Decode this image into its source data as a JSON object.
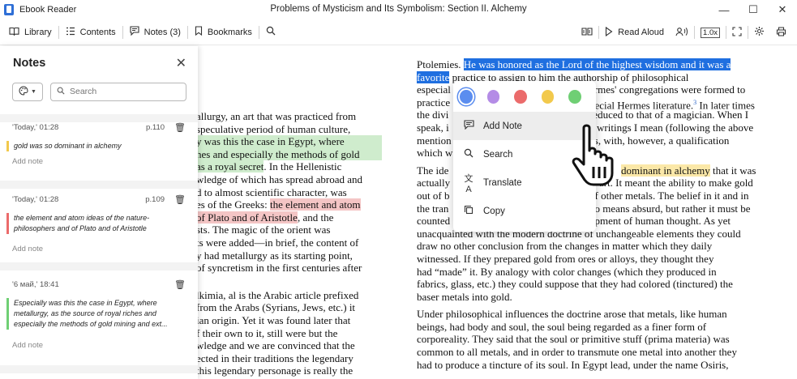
{
  "window": {
    "app_name": "Ebook Reader",
    "doc_title": "Problems of Mysticism and Its Symbolism: Section II. Alchemy",
    "controls": [
      "—",
      "☐",
      "✕"
    ]
  },
  "toolbar": {
    "library": "Library",
    "contents": "Contents",
    "notes": "Notes (3)",
    "bookmarks": "Bookmarks",
    "read_aloud": "Read Aloud",
    "speed": "1.0x"
  },
  "notes_panel": {
    "title": "Notes",
    "search_placeholder": "Search",
    "add_note_label": "Add note",
    "items": [
      {
        "time": "'Today,' 01:28",
        "page": "p.110",
        "text": "gold was so dominant in alchemy",
        "color": "#f2c94c"
      },
      {
        "time": "'Today,' 01:28",
        "page": "p.109",
        "text": "the element and atom ideas of the nature-philosophers and of Plato and of Aristotle",
        "color": "#eb6b6b"
      },
      {
        "time": "'6 май,' 18:41",
        "page": "",
        "text": "Especially was this the case in Egypt, where metallurgy, as the source of royal riches and especially the methods of gold mining and ext...",
        "color": "#6fcf74"
      }
    ]
  },
  "left_page": {
    "block1": [
      "allurgy, an art that was practiced from",
      "speculative period of human culture,",
      "y was this the case in Egypt, where",
      "hes and especially the methods of gold",
      " as a royal secret. In the Hellenistic",
      "wledge of which has spread abroad and",
      "d to almost scientific character, was",
      "es of the Greeks: the element and atom",
      " of Plato and of Aristotle, and the",
      "sts. The magic of the orient was",
      "ts were added—in brief, the content of",
      "y had metallurgy as its starting point,",
      " of syncretism in the first centuries after"
    ],
    "block2": [
      "lkimia, al is the Arabic article prefixed",
      "from the Arabs (Syrians, Jews, etc.) it",
      "ian origin. Yet it was found later that",
      "f their own to it, still were but the",
      "wledge and we are convinced that the",
      "ected in their traditions the legendary",
      "this legendary personage is really the"
    ]
  },
  "right_page": {
    "l1a": "Ptolemies. ",
    "l1b": "He was honored as the Lord of the highest wisdom and it was a",
    "l2a": "favorite",
    "l2b": " practice to assign to him the authorship of philosophical",
    "l3a": "especial",
    "l3b": "ermes' congregations were formed to",
    "l4a": "practice",
    "l4b": "pecial Hermes literature.",
    "l4sup": "3",
    "l4c": " In later times",
    "l5a": "the divi",
    "l5b": "reduced to that of a magician. When I",
    "l6a": "speak, i",
    "l6b": "c writings I mean (following the above",
    "l7a": "mention",
    "l7b": "es, with, however, a qualification",
    "l8a": "which w",
    "p2l1a": "The ide",
    "p2l1b": "dominant in alchemy",
    "p2l1c": " that it was",
    "p2l2a": "actually",
    "p2l2b": "ts art. It meant the ability to make gold",
    "p2l3a": "out of b",
    "p2l3b": "of other metals. The belief in it and in",
    "p2l4a": "the tran",
    "p2l4b": "no means absurd, but rather it must be",
    "p2l5a": "counted",
    "p2l5b": "opment of human thought. As yet",
    "rest": [
      "unacquainted with the modern doctrine of unchangeable elements they could",
      "draw no other conclusion from the changes in matter which they daily",
      "witnessed. If they prepared gold from ores or alloys, they thought they",
      "had “made” it. By analogy with color changes (which they produced in",
      "fabrics, glass, etc.) they could suppose that they had colored (tinctured) the",
      "baser metals into gold."
    ],
    "p3": [
      "Under philosophical influences the doctrine arose that metals, like human",
      "beings, had body and soul, the soul being regarded as a finer form of",
      "corporeality. They said that the soul or primitive stuff (prima materia) was",
      "common to all metals, and in order to transmute one metal into another they",
      "had to produce a tincture of its soul. In Egypt lead, under the name Osiris,"
    ]
  },
  "popup": {
    "colors": [
      "#5b8def",
      "#b48ce6",
      "#eb6b6b",
      "#f2c94c",
      "#6fcf74"
    ],
    "items": [
      "Add Note",
      "Search",
      "Translate",
      "Copy"
    ]
  }
}
